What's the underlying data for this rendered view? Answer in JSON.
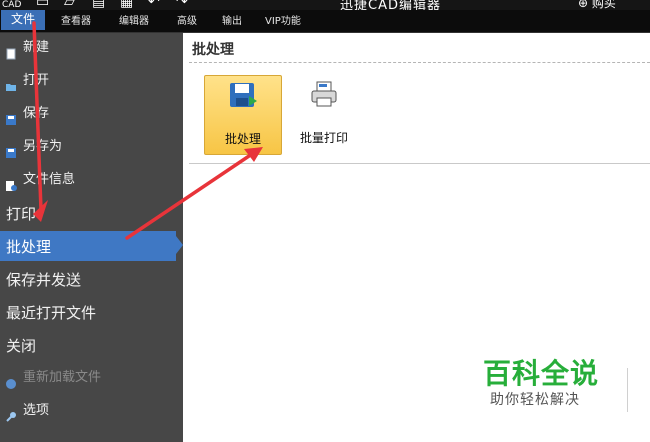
{
  "window": {
    "title": "迅捷CAD编辑器",
    "app_badge": "CAD",
    "buy_label": "购买"
  },
  "menubar": {
    "items": [
      {
        "label": "文件",
        "active": true
      },
      {
        "label": "查看器"
      },
      {
        "label": "编辑器"
      },
      {
        "label": "高级"
      },
      {
        "label": "输出"
      },
      {
        "label": "VIP功能"
      }
    ]
  },
  "sidebar": {
    "items": [
      {
        "label": "新建",
        "icon": "new-file-icon"
      },
      {
        "label": "打开",
        "icon": "open-folder-icon"
      },
      {
        "label": "保存",
        "icon": "save-icon"
      },
      {
        "label": "另存为",
        "icon": "save-as-icon"
      },
      {
        "label": "文件信息",
        "icon": "file-info-icon"
      },
      {
        "label": "打印"
      },
      {
        "label": "批处理",
        "selected": true
      },
      {
        "label": "保存并发送"
      },
      {
        "label": "最近打开文件"
      },
      {
        "label": "关闭"
      },
      {
        "label": "重新加载文件",
        "icon": "reload-icon",
        "disabled": true
      },
      {
        "label": "选项",
        "icon": "wrench-icon"
      }
    ]
  },
  "content": {
    "title": "批处理",
    "tools": [
      {
        "label": "批处理",
        "icon": "batch-process-icon",
        "selected": true
      },
      {
        "label": "批量打印",
        "icon": "batch-print-icon"
      }
    ]
  },
  "watermark": {
    "main": "百科全说",
    "sub": "助你轻松解决"
  },
  "colors": {
    "accent": "#3f78c4",
    "sidebar_bg": "#474747",
    "arrow": "#e8343a",
    "watermark_green": "#27ae3a",
    "selected_tool": "#f7c545"
  }
}
